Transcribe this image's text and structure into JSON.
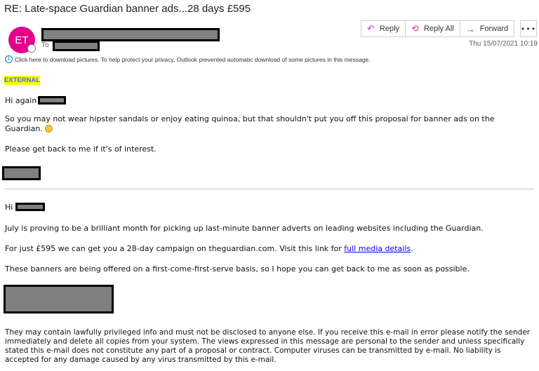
{
  "header": {
    "subject": "RE: Late-space Guardian banner ads...28 days £595",
    "avatar_initials": "ET",
    "avatar_color": "#e3008c",
    "to_label": "To",
    "date": "Thu 15/07/2021 10:19",
    "info_bar": "Click here to download pictures. To help protect your privacy, Outlook prevented automatic download of some pictures in this message."
  },
  "actions": {
    "reply": "Reply",
    "reply_all": "Reply All",
    "forward": "Forward",
    "more": "•••"
  },
  "body": {
    "external_tag": "EXTERNAL",
    "greeting1": "Hi again",
    "para1": "So you may not wear hipster sandals or enjoy eating quinoa, but that shouldn't put you off this proposal for banner ads on the Guardian.",
    "para2": "Please get back to me if it's of interest.",
    "greeting2": "Hi",
    "para3": "July is proving to be a brilliant month for picking up last-minute banner adverts on leading websites including the Guardian.",
    "para4_pre": "For just £595 we can get you a 28-day campaign on theguardian.com. Visit this link for ",
    "para4_link": "full media details",
    "para4_post": ".",
    "para5": "These banners are being offered on a first-come-first-serve basis, so I hope you can get back to me as soon as possible.",
    "disclaimer": "They may contain lawfully privileged info and must not be disclosed to anyone else. If you receive this e-mail in error please notify the sender immediately and delete all copies from your system. The views expressed in this message are personal to the sender and unless specifically stated this e-mail does not constitute any part of a proposal or contract. Computer viruses can be transmitted by e-mail.  No liability is accepted for any damage caused by any virus transmitted by this e-mail."
  }
}
